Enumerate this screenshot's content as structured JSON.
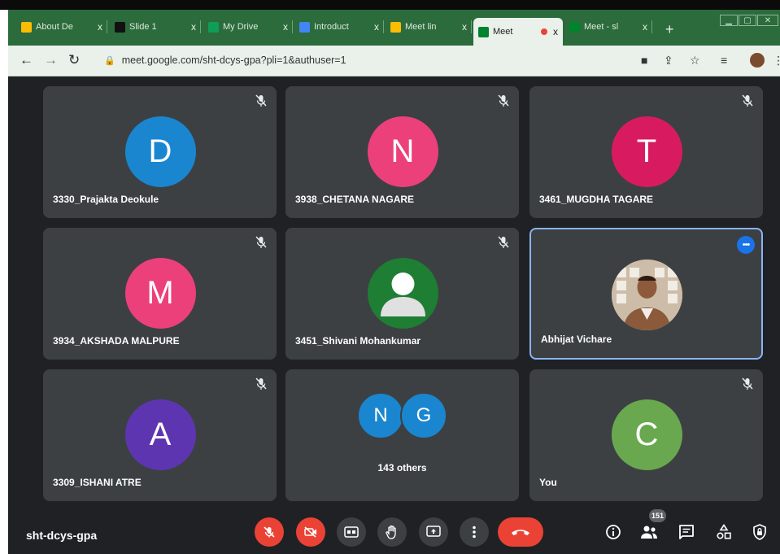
{
  "browser": {
    "tabs": [
      {
        "label": "About De",
        "favicon_color": "#fbbc04"
      },
      {
        "label": "Slide 1",
        "favicon_color": "#111111"
      },
      {
        "label": "My Drive",
        "favicon_color": "#0f9d58"
      },
      {
        "label": "Introduct",
        "favicon_color": "#4285f4"
      },
      {
        "label": "Meet lin",
        "favicon_color": "#fbbc04"
      },
      {
        "label": "Meet",
        "favicon_color": "#00832d",
        "active": true
      },
      {
        "label": "Meet - sl",
        "favicon_color": "#00832d"
      }
    ],
    "tab_close_glyph": "x",
    "new_tab_glyph": "+",
    "url": "meet.google.com/sht-dcys-gpa?pli=1&authuser=1"
  },
  "meet": {
    "code": "sht-dcys-gpa",
    "participants": [
      {
        "initial": "D",
        "name": "3330_Prajakta Deokule",
        "color": "#1a86d0",
        "muted": true
      },
      {
        "initial": "N",
        "name": "3938_CHETANA NAGARE",
        "color": "#ec407a",
        "muted": true
      },
      {
        "initial": "T",
        "name": "3461_MUGDHA TAGARE",
        "color": "#d81b60",
        "muted": true
      },
      {
        "initial": "M",
        "name": "3934_AKSHADA MALPURE",
        "color": "#ec407a",
        "muted": true
      },
      {
        "initial": "",
        "name": "3451_Shivani Mohankumar",
        "color": "#1e7e34",
        "muted": true,
        "avatar": "person-silhouette"
      },
      {
        "initial": "",
        "name": "Abhijat Vichare",
        "color": "#8d6e63",
        "muted": false,
        "avatar": "photo",
        "pinned": true
      },
      {
        "initial": "A",
        "name": "3309_ISHANI ATRE",
        "color": "#5e35b1",
        "muted": true
      },
      {
        "others_initials": [
          "N",
          "G"
        ],
        "others_colors": [
          "#1a86d0",
          "#1a86d0"
        ],
        "others_label": "143 others"
      },
      {
        "initial": "C",
        "name": "You",
        "color": "#6aa84f",
        "muted": true
      }
    ],
    "people_count": "151"
  },
  "colors": {
    "red": "#ea4335",
    "control_bg": "#3c4043",
    "meeting_bg": "#202124"
  }
}
